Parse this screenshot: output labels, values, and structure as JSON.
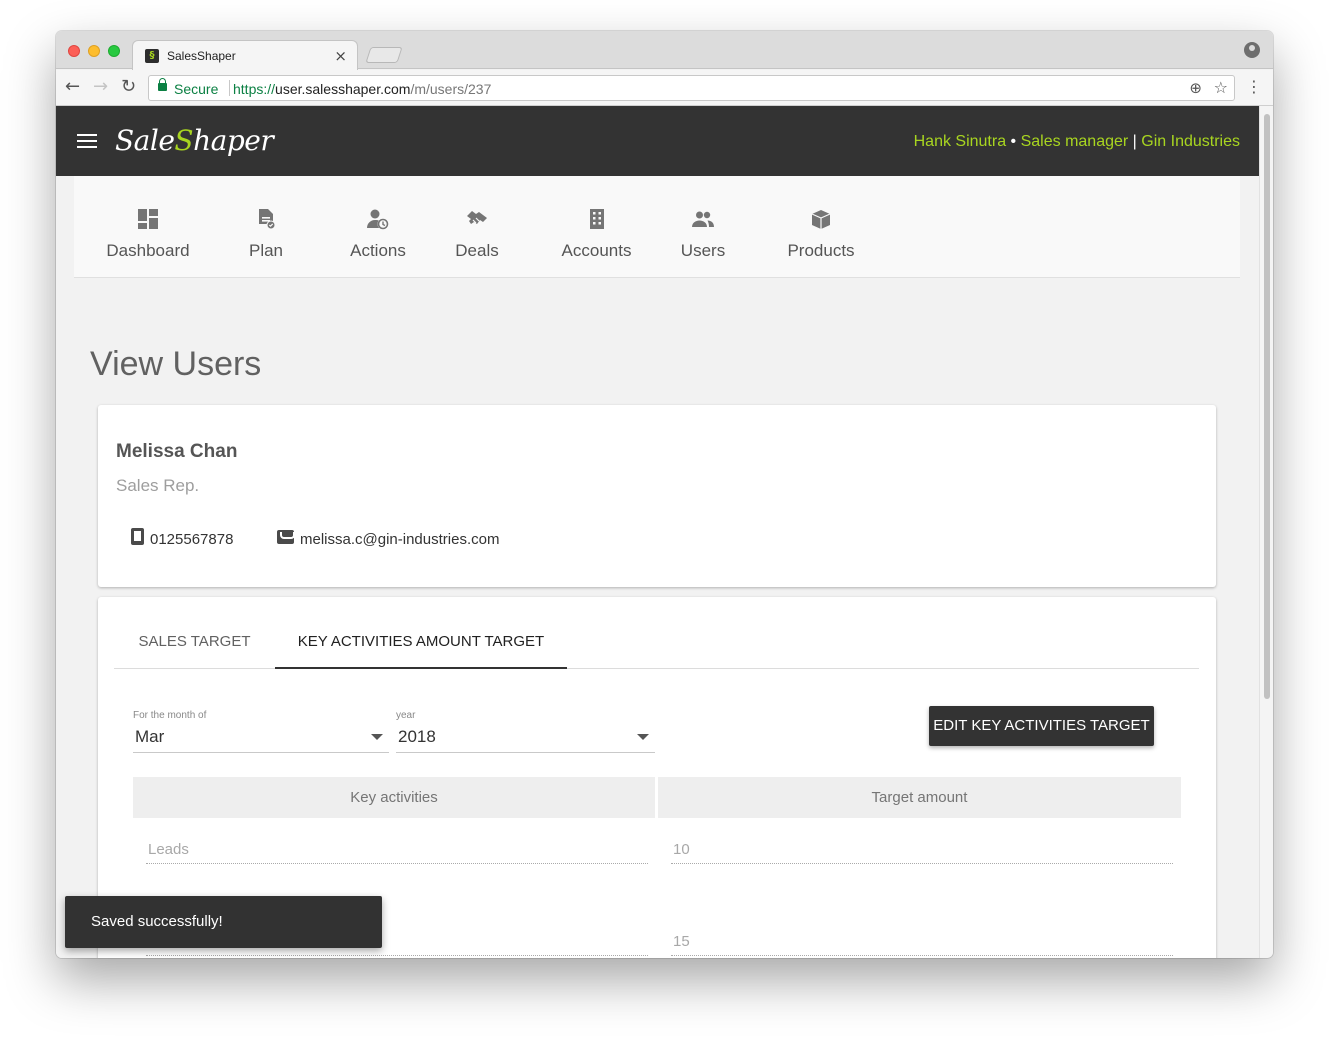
{
  "browser": {
    "tab_title": "SalesShaper",
    "tab_close": "×",
    "secure_label": "Secure",
    "url_scheme": "https://",
    "url_host": "user.salesshaper.com",
    "url_path": "/m/users/237"
  },
  "app": {
    "logo_part1": "Sale",
    "logo_accent": "S",
    "logo_part2": "haper",
    "user_name": "Hank Sinutra",
    "user_role": "Sales manager",
    "company": "Gin Industries",
    "dot_sep": " • ",
    "bar_sep": " | ",
    "accent_color": "#a8d520",
    "appbar_color": "#333333"
  },
  "nav": {
    "items": [
      {
        "label": "Dashboard",
        "icon": "dashboard-icon"
      },
      {
        "label": "Plan",
        "icon": "plan-icon"
      },
      {
        "label": "Actions",
        "icon": "actions-icon"
      },
      {
        "label": "Deals",
        "icon": "handshake-icon"
      },
      {
        "label": "Accounts",
        "icon": "building-icon"
      },
      {
        "label": "Users",
        "icon": "users-icon"
      },
      {
        "label": "Products",
        "icon": "box-icon"
      }
    ]
  },
  "page": {
    "title": "View Users"
  },
  "profile": {
    "name": "Melissa Chan",
    "role": "Sales Rep.",
    "phone": "0125567878",
    "email": "melissa.c@gin-industries.com"
  },
  "targets": {
    "tabs": [
      "SALES TARGET",
      "KEY ACTIVITIES AMOUNT TARGET"
    ],
    "active_tab": "KEY ACTIVITIES AMOUNT TARGET",
    "month_label": "For the month of",
    "month_value": "Mar",
    "year_label": "year",
    "year_value": "2018",
    "edit_button": "EDIT KEY ACTIVITIES TARGET",
    "columns": [
      "Key activities",
      "Target amount"
    ],
    "rows": [
      {
        "activity": "Leads",
        "amount": "10"
      },
      {
        "activity": "",
        "amount": "15"
      }
    ]
  },
  "toast": {
    "message": "Saved successfully!"
  }
}
